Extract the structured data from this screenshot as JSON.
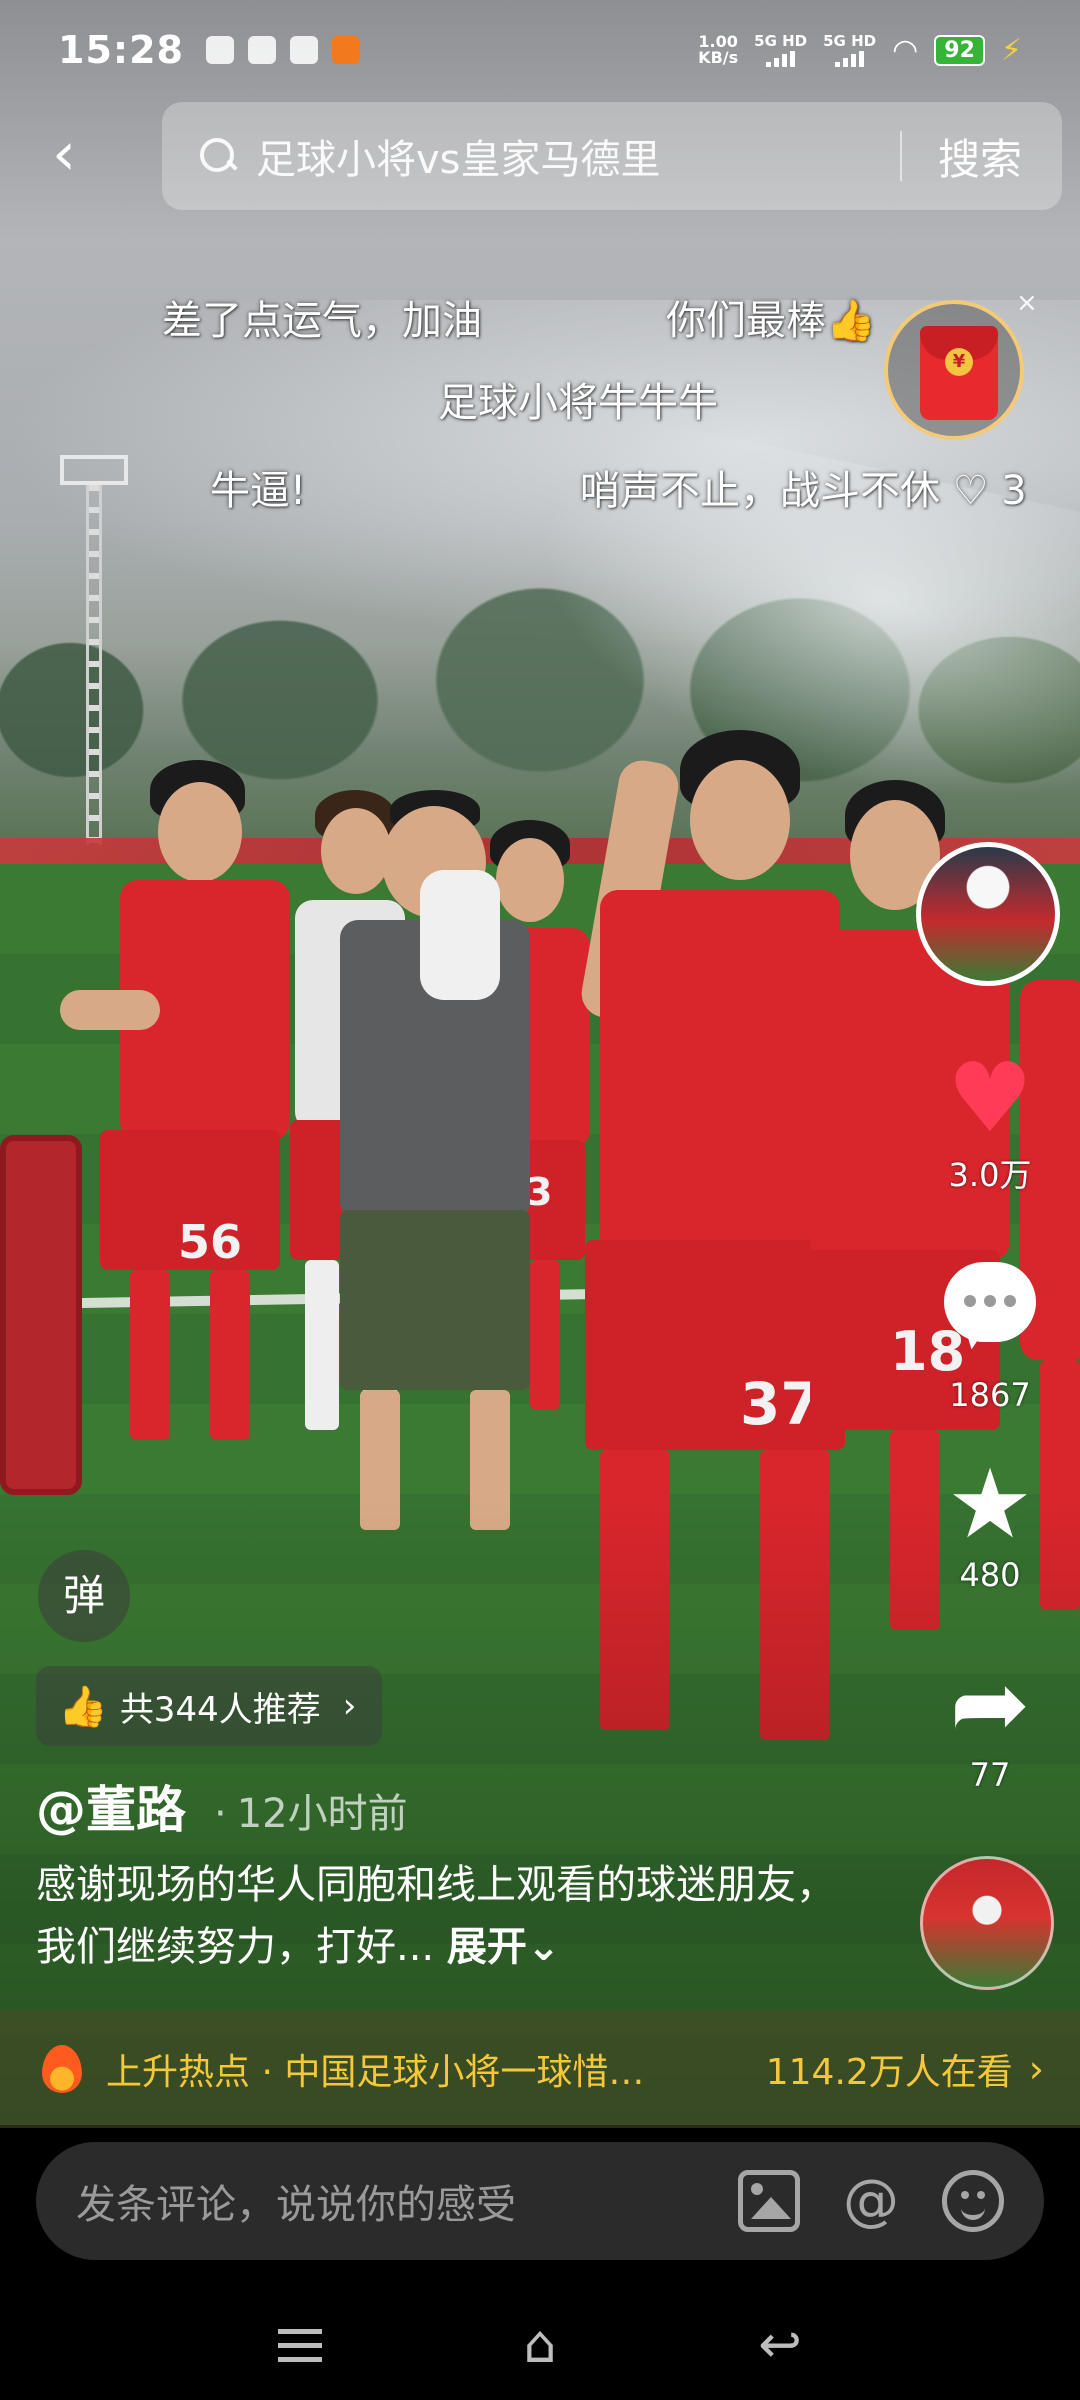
{
  "status_bar": {
    "time": "15:28",
    "net_speed_value": "1.00",
    "net_speed_unit": "KB/s",
    "sim1": "5G HD",
    "sim2": "5G HD",
    "battery": "92"
  },
  "search": {
    "query": "足球小将vs皇家马德里",
    "button_label": "搜索"
  },
  "danmaku": [
    "差了点运气，加油",
    "你们最棒👍",
    "足球小将牛牛牛",
    "牛逼!",
    "哨声不止，战斗不休 ♡ 3"
  ],
  "red_packet": {
    "coin_symbol": "¥",
    "close": "×"
  },
  "video_overlay_numbers": [
    "56",
    "3",
    "37",
    "18"
  ],
  "actions": {
    "likes": "3.0万",
    "comments": "1867",
    "favorites": "480",
    "shares": "77"
  },
  "danmu_toggle_label": "弹",
  "recommend": {
    "label": "共344人推荐"
  },
  "author": {
    "name": "@董路",
    "time": "12小时前"
  },
  "caption": {
    "text": "感谢现场的华人同胞和线上观看的球迷朋友，我们继续努力，打好...",
    "expand": "展开"
  },
  "hot_topic": {
    "text": "上升热点 · 中国足球小将一球惜…",
    "viewers": "114.2万人在看"
  },
  "comment_input": {
    "placeholder": "发条评论，说说你的感受"
  },
  "colors": {
    "accent_heart": "#ff3b57",
    "hot_text": "#f5c83a",
    "jersey_red": "#d8262c"
  }
}
